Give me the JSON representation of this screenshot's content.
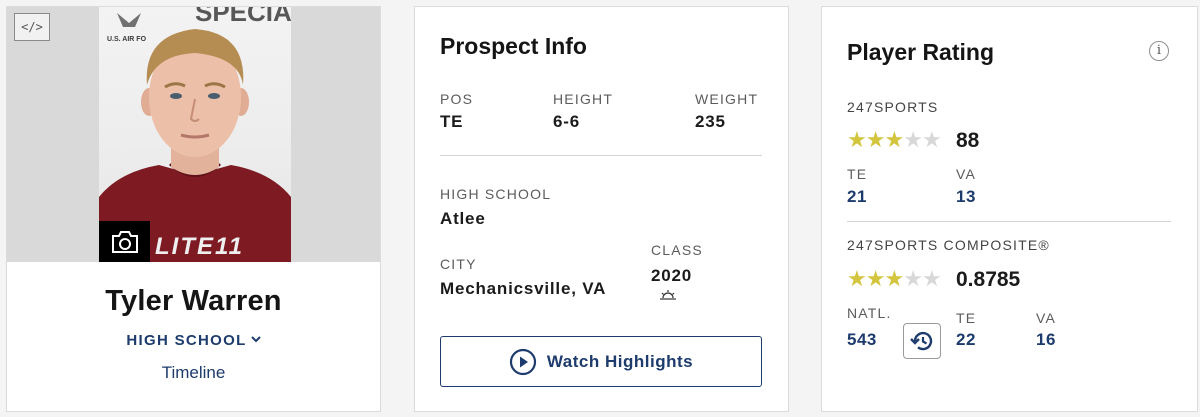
{
  "profile": {
    "embed_label": "</>",
    "name": "Tyler Warren",
    "school_dropdown": "HIGH SCHOOL",
    "timeline_link": "Timeline",
    "photo_jersey_text": "LITE11",
    "photo_backdrop_text": "SPECIAL",
    "photo_logo_text": "U.S. AIR FO"
  },
  "prospect": {
    "title": "Prospect Info",
    "pos_label": "POS",
    "pos_value": "TE",
    "height_label": "HEIGHT",
    "height_value": "6-6",
    "weight_label": "WEIGHT",
    "weight_value": "235",
    "school_label": "HIGH SCHOOL",
    "school_value": "Atlee",
    "city_label": "CITY",
    "city_value": "Mechanicsville, VA",
    "class_label": "CLASS",
    "class_value": "2020",
    "watch_button": "Watch Highlights"
  },
  "rating": {
    "title": "Player Rating",
    "info_icon": "info-icon",
    "sports247": {
      "label": "247SPORTS",
      "stars": 3,
      "max_stars": 5,
      "score": "88",
      "ranks": [
        {
          "label": "TE",
          "value": "21"
        },
        {
          "label": "VA",
          "value": "13"
        }
      ]
    },
    "composite": {
      "label": "247SPORTS COMPOSITE®",
      "stars": 3,
      "max_stars": 5,
      "score": "0.8785",
      "ranks": [
        {
          "label": "NATL.",
          "value": "543"
        },
        {
          "label": "TE",
          "value": "22"
        },
        {
          "label": "VA",
          "value": "16"
        }
      ]
    }
  },
  "colors": {
    "brand_navy": "#1d3b6c",
    "star_gold": "#d3c63e",
    "star_empty": "#d8d8d8",
    "jersey": "#7d1a22"
  }
}
